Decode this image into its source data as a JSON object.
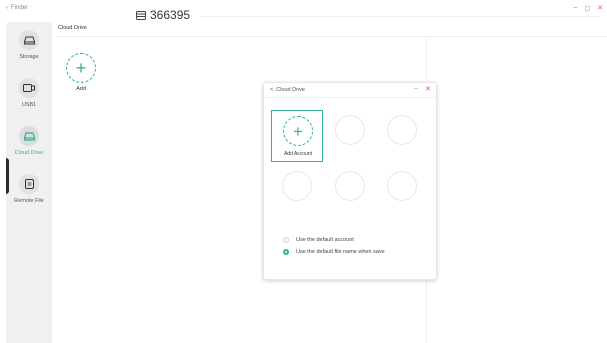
{
  "window": {
    "back_label": "Finder",
    "minimize_symbol": "–",
    "restore_symbol": "◻",
    "close_symbol": "✕"
  },
  "badge": {
    "number": "366395",
    "icon": "window-icon"
  },
  "sidebar": {
    "items": [
      {
        "label": "Storage",
        "icon": "storage-icon",
        "active": false
      },
      {
        "label": "USB1",
        "icon": "usb-icon",
        "active": false
      },
      {
        "label": "Cloud Drive",
        "icon": "cloud-drive-icon",
        "active": true
      },
      {
        "label": "Remote File",
        "icon": "remote-file-icon",
        "active": false
      }
    ]
  },
  "main": {
    "title": "Cloud Drive",
    "add_label": "Add",
    "add_symbol": "+"
  },
  "dialog": {
    "title": "Cloud Drive",
    "back_symbol": "<",
    "minimize_symbol": "–",
    "close_symbol": "✕",
    "add_account_label": "Add Account",
    "add_symbol": "+",
    "options": [
      {
        "label": "Use the default account",
        "checked": false
      },
      {
        "label": "Use the default file name when save",
        "checked": true
      }
    ]
  },
  "colors": {
    "accent": "#2fb39a",
    "close": "#e05555",
    "sidebar_bg": "#f0f0f0"
  }
}
